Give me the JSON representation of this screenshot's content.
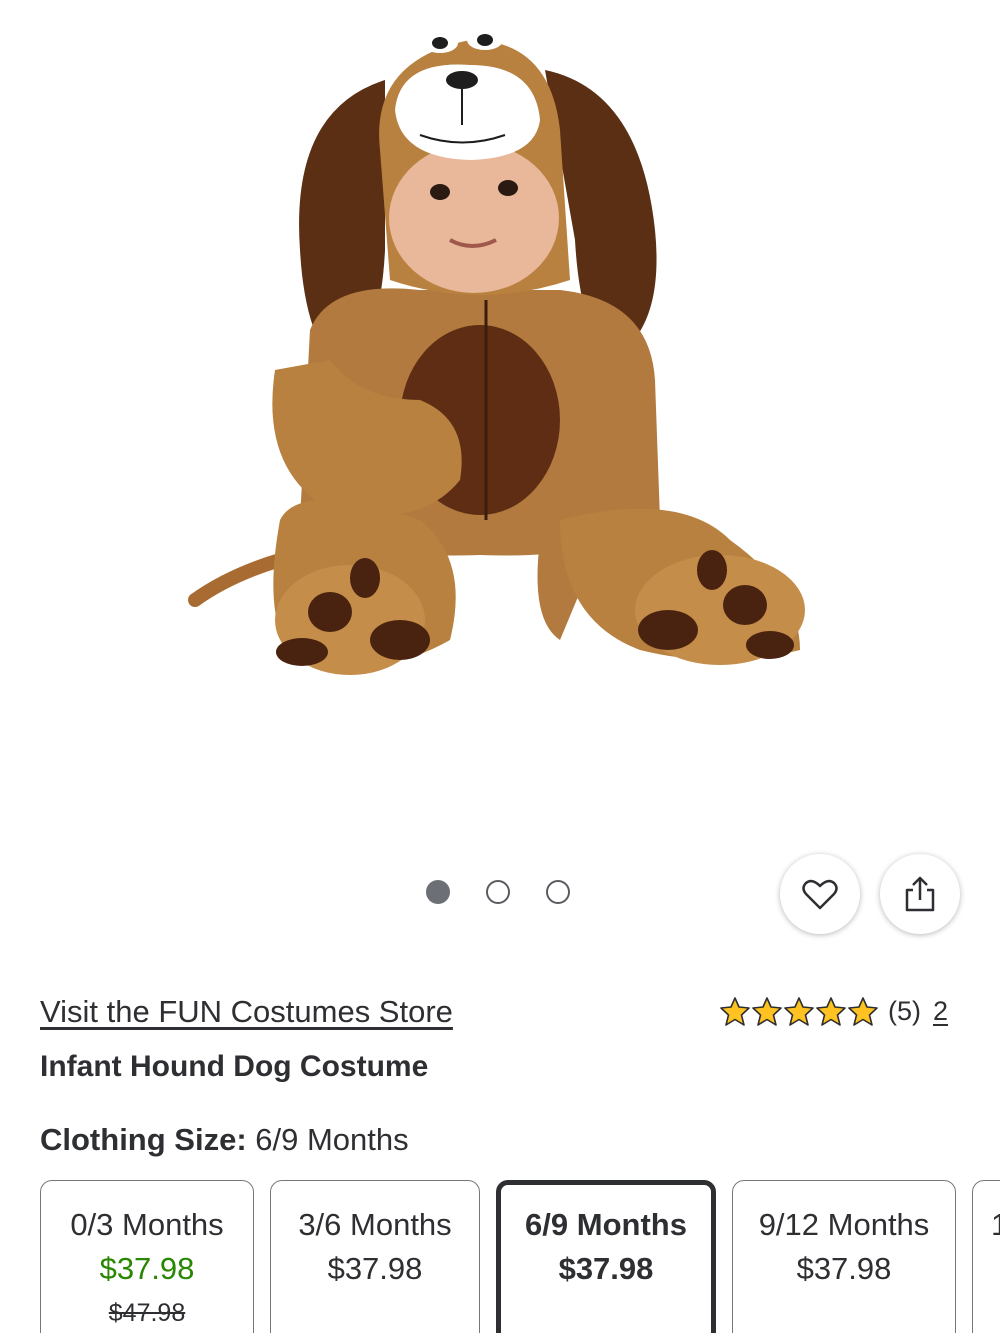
{
  "product": {
    "store_link": "Visit the FUN Costumes Store",
    "title": "Infant Hound Dog Costume",
    "rating": {
      "stars": 5,
      "count": "(5)",
      "link": "2"
    },
    "size_label": "Clothing Size:",
    "size_value": "6/9 Months"
  },
  "carousel": {
    "total": 3,
    "active": 1
  },
  "icons": {
    "favorite": "heart-icon",
    "share": "share-icon",
    "rating": "star-icon"
  },
  "colors": {
    "sale": "#2a8703",
    "star": "#ffc220",
    "text": "#2e2f32"
  },
  "variants": [
    {
      "label": "0/3 Months",
      "price": "$37.98",
      "was": "$47.98",
      "selected": false
    },
    {
      "label": "3/6 Months",
      "price": "$37.98",
      "selected": false
    },
    {
      "label": "6/9 Months",
      "price": "$37.98",
      "selected": true
    },
    {
      "label": "9/12 Months",
      "price": "$37.98",
      "selected": false
    },
    {
      "label": "1",
      "selected": false
    }
  ]
}
